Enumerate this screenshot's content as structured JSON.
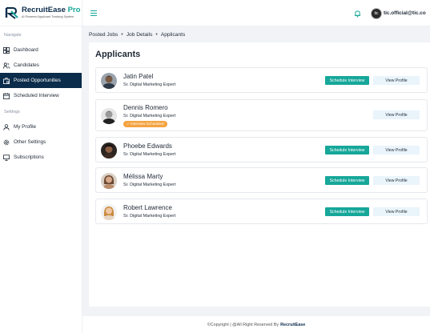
{
  "brand": {
    "name_main": "RecruitEase",
    "name_accent": "Pro",
    "tagline": "AI Powered Applicant Tracking System",
    "primary_color": "#0b2c4a",
    "accent_color": "#16a79a"
  },
  "sidebar": {
    "navigate_label": "Navigate",
    "settings_label": "Settings",
    "items": [
      {
        "label": "Dashboard",
        "icon": "dashboard-icon"
      },
      {
        "label": "Candidates",
        "icon": "users-icon"
      },
      {
        "label": "Posted Opportunities",
        "icon": "briefcase-icon",
        "active": true
      },
      {
        "label": "Scheduled Interview",
        "icon": "calendar-icon"
      }
    ],
    "settings_items": [
      {
        "label": "My Profile",
        "icon": "user-icon"
      },
      {
        "label": "Other Settings",
        "icon": "gear-icon"
      },
      {
        "label": "Subscriptions",
        "icon": "monitor-icon"
      }
    ]
  },
  "topbar": {
    "user_name": "tic.official@tic.co",
    "avatar_text": "tic"
  },
  "breadcrumb": [
    "Posted Jobs",
    "Job Details",
    "Applicants"
  ],
  "page": {
    "title": "Applicants"
  },
  "applicants": [
    {
      "name": "Jatin Patel",
      "title": "Sr. Digital Marketing Expert",
      "schedule_label": "Schedule Interview",
      "view_label": "View Profile"
    },
    {
      "name": "Dennis Romero",
      "title": "Sr. Digital Marketing Expert",
      "status": "✓ Interview Scheduled",
      "view_label": "View Profile"
    },
    {
      "name": "Phoebe Edwards",
      "title": "Sr. Digital Marketing Expert",
      "schedule_label": "Schedule Interview",
      "view_label": "View Profile"
    },
    {
      "name": "Mélissa Marty",
      "title": "Sr. Digital Marketing Expert",
      "schedule_label": "Schedule Interview",
      "view_label": "View Profile"
    },
    {
      "name": "Robert Lawrence",
      "title": "Sr. Digital Marketing Expert",
      "schedule_label": "Schedule Interview",
      "view_label": "View Profile"
    }
  ],
  "footer": {
    "text": "©Copyright | @All Right Reserved By",
    "brand": "RecruitEase"
  }
}
